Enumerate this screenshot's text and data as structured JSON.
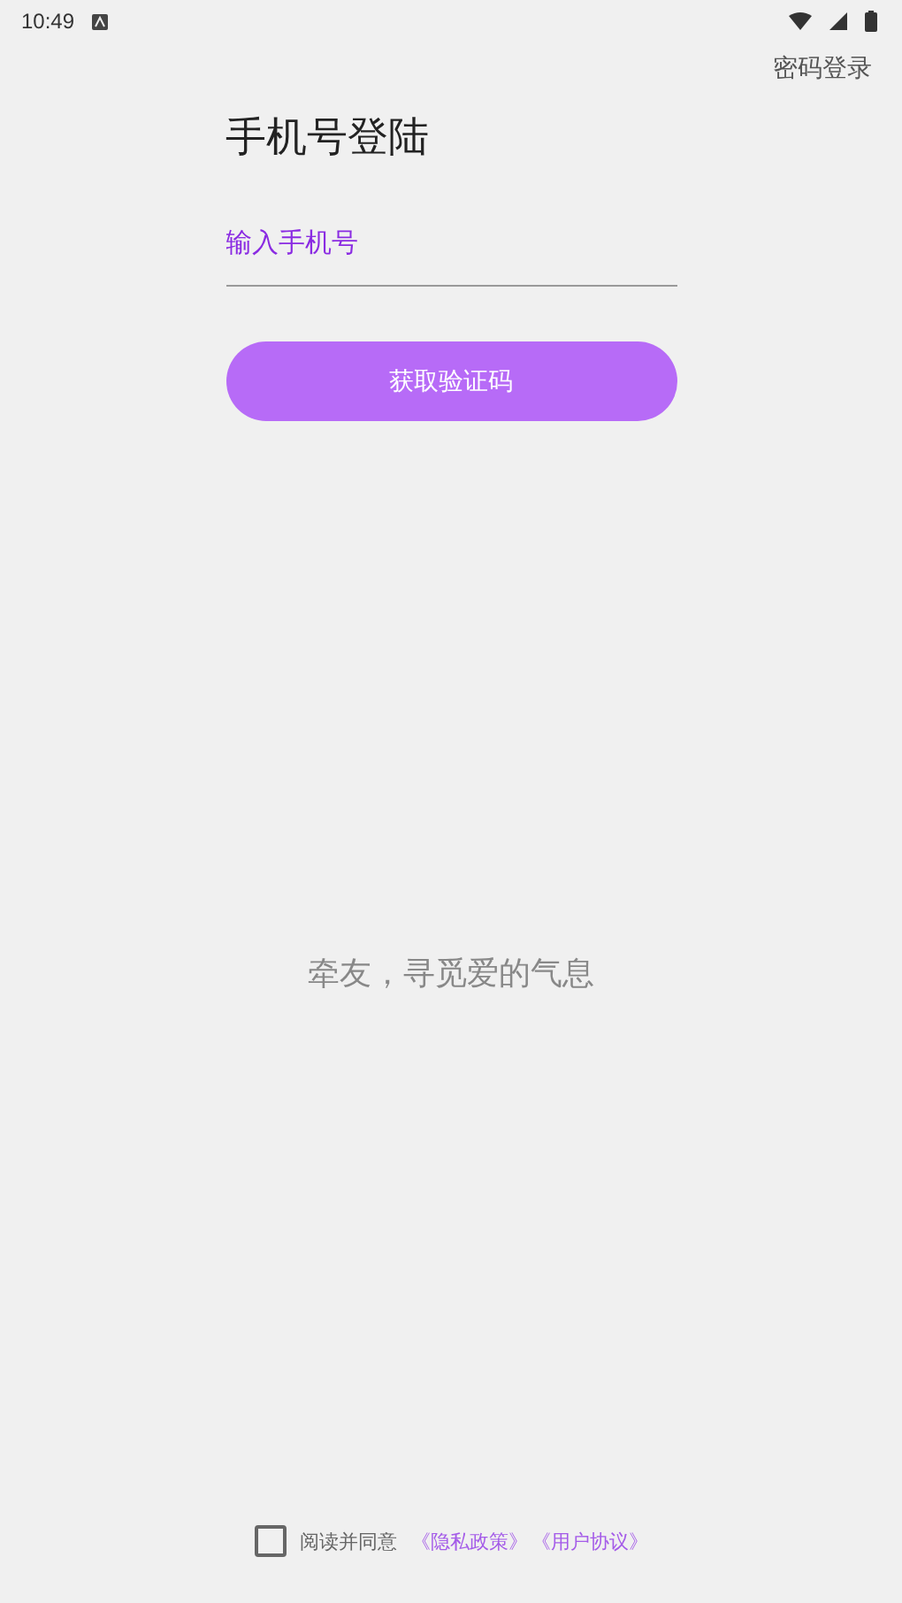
{
  "status_bar": {
    "time": "10:49"
  },
  "top_link": "密码登录",
  "title": "手机号登陆",
  "phone_field": {
    "placeholder": "输入手机号"
  },
  "submit_button": "获取验证码",
  "slogan": "牵友，寻觅爱的气息",
  "agreement": {
    "checked": false,
    "text": "阅读并同意",
    "links": [
      "《隐私政策》",
      "《用户协议》"
    ]
  }
}
